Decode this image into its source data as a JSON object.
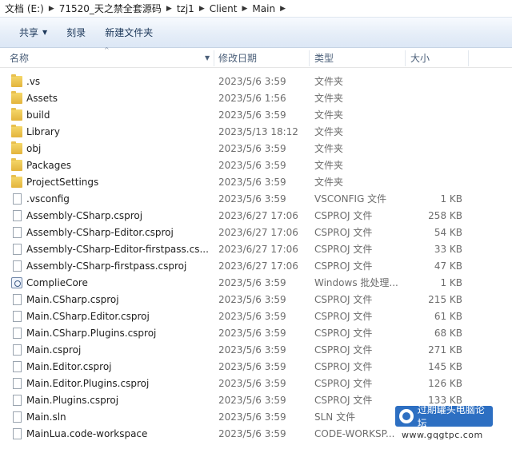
{
  "breadcrumb": [
    "文档 (E:)",
    "71520_天之禁全套源码",
    "tzj1",
    "Client",
    "Main"
  ],
  "toolbar": {
    "share": "共享",
    "burn": "刻录",
    "new_folder": "新建文件夹"
  },
  "columns": {
    "name": "名称",
    "date": "修改日期",
    "type": "类型",
    "size": "大小"
  },
  "files": [
    {
      "name": ".vs",
      "date": "2023/5/6 3:59",
      "type": "文件夹",
      "size": "",
      "icon": "folder"
    },
    {
      "name": "Assets",
      "date": "2023/5/6 1:56",
      "type": "文件夹",
      "size": "",
      "icon": "folder"
    },
    {
      "name": "build",
      "date": "2023/5/6 3:59",
      "type": "文件夹",
      "size": "",
      "icon": "folder"
    },
    {
      "name": "Library",
      "date": "2023/5/13 18:12",
      "type": "文件夹",
      "size": "",
      "icon": "folder"
    },
    {
      "name": "obj",
      "date": "2023/5/6 3:59",
      "type": "文件夹",
      "size": "",
      "icon": "folder"
    },
    {
      "name": "Packages",
      "date": "2023/5/6 3:59",
      "type": "文件夹",
      "size": "",
      "icon": "folder"
    },
    {
      "name": "ProjectSettings",
      "date": "2023/5/6 3:59",
      "type": "文件夹",
      "size": "",
      "icon": "folder"
    },
    {
      "name": ".vsconfig",
      "date": "2023/5/6 3:59",
      "type": "VSCONFIG 文件",
      "size": "1 KB",
      "icon": "file"
    },
    {
      "name": "Assembly-CSharp.csproj",
      "date": "2023/6/27 17:06",
      "type": "CSPROJ 文件",
      "size": "258 KB",
      "icon": "file"
    },
    {
      "name": "Assembly-CSharp-Editor.csproj",
      "date": "2023/6/27 17:06",
      "type": "CSPROJ 文件",
      "size": "54 KB",
      "icon": "file"
    },
    {
      "name": "Assembly-CSharp-Editor-firstpass.cs...",
      "date": "2023/6/27 17:06",
      "type": "CSPROJ 文件",
      "size": "33 KB",
      "icon": "file"
    },
    {
      "name": "Assembly-CSharp-firstpass.csproj",
      "date": "2023/6/27 17:06",
      "type": "CSPROJ 文件",
      "size": "47 KB",
      "icon": "file"
    },
    {
      "name": "ComplieCore",
      "date": "2023/5/6 3:59",
      "type": "Windows 批处理...",
      "size": "1 KB",
      "icon": "batch"
    },
    {
      "name": "Main.CSharp.csproj",
      "date": "2023/5/6 3:59",
      "type": "CSPROJ 文件",
      "size": "215 KB",
      "icon": "file"
    },
    {
      "name": "Main.CSharp.Editor.csproj",
      "date": "2023/5/6 3:59",
      "type": "CSPROJ 文件",
      "size": "61 KB",
      "icon": "file"
    },
    {
      "name": "Main.CSharp.Plugins.csproj",
      "date": "2023/5/6 3:59",
      "type": "CSPROJ 文件",
      "size": "68 KB",
      "icon": "file"
    },
    {
      "name": "Main.csproj",
      "date": "2023/5/6 3:59",
      "type": "CSPROJ 文件",
      "size": "271 KB",
      "icon": "file"
    },
    {
      "name": "Main.Editor.csproj",
      "date": "2023/5/6 3:59",
      "type": "CSPROJ 文件",
      "size": "145 KB",
      "icon": "file"
    },
    {
      "name": "Main.Editor.Plugins.csproj",
      "date": "2023/5/6 3:59",
      "type": "CSPROJ 文件",
      "size": "126 KB",
      "icon": "file"
    },
    {
      "name": "Main.Plugins.csproj",
      "date": "2023/5/6 3:59",
      "type": "CSPROJ 文件",
      "size": "133 KB",
      "icon": "file"
    },
    {
      "name": "Main.sln",
      "date": "2023/5/6 3:59",
      "type": "SLN 文件",
      "size": "",
      "icon": "file"
    },
    {
      "name": "MainLua.code-workspace",
      "date": "2023/5/6 3:59",
      "type": "CODE-WORKSP...",
      "size": "",
      "icon": "file"
    }
  ],
  "watermark": {
    "text": "过期罐头电脑论坛",
    "url": "www.gqgtpc.com"
  }
}
